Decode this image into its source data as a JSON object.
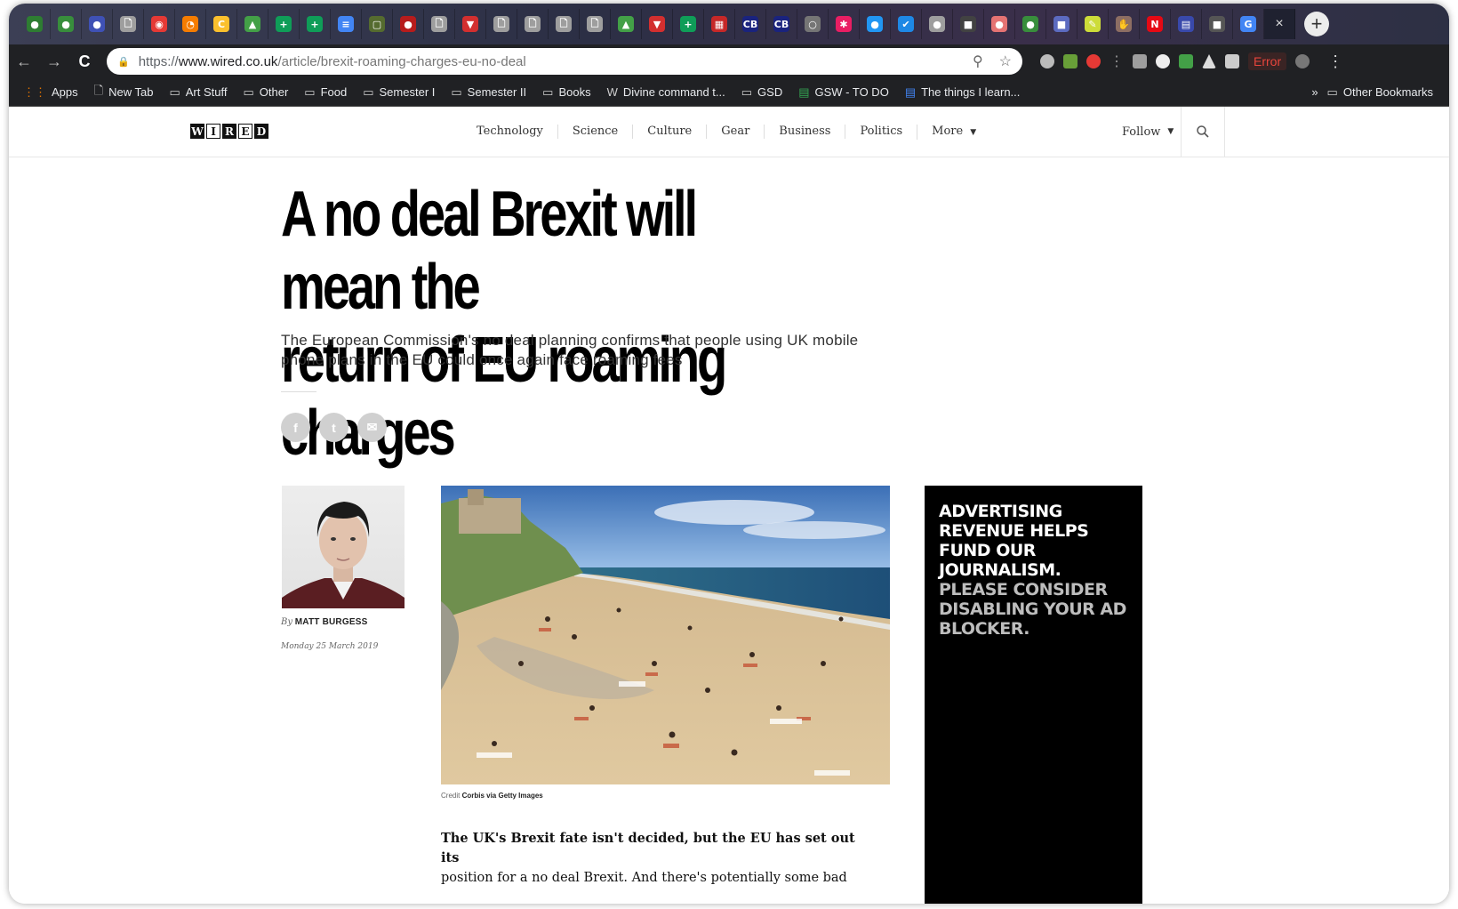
{
  "browser": {
    "tabs": [
      {
        "icon": "leaf-icon",
        "color": "#2e7d32",
        "glyph": "●"
      },
      {
        "icon": "leaf-icon",
        "color": "#388e3c",
        "glyph": "●"
      },
      {
        "icon": "circle-icon",
        "color": "#3f51b5",
        "glyph": "●"
      },
      {
        "icon": "page-icon",
        "color": "#9e9e9e",
        "glyph": "🗋"
      },
      {
        "icon": "map-pin-icon",
        "color": "#e53935",
        "glyph": "◉"
      },
      {
        "icon": "colorwheel-icon",
        "color": "#f57c00",
        "glyph": "◔"
      },
      {
        "icon": "canvas-icon",
        "color": "#fbc02d",
        "glyph": "C"
      },
      {
        "icon": "drive-icon",
        "color": "#43a047",
        "glyph": "▲"
      },
      {
        "icon": "sheets-icon",
        "color": "#0f9d58",
        "glyph": "+"
      },
      {
        "icon": "sheets-icon",
        "color": "#0f9d58",
        "glyph": "+"
      },
      {
        "icon": "docs-icon",
        "color": "#4285f4",
        "glyph": "≡"
      },
      {
        "icon": "page-icon",
        "color": "#556b2f",
        "glyph": "▢"
      },
      {
        "icon": "circle-icon",
        "color": "#b71c1c",
        "glyph": "●"
      },
      {
        "icon": "page-icon",
        "color": "#9e9e9e",
        "glyph": "🗋"
      },
      {
        "icon": "shield-icon",
        "color": "#d32f2f",
        "glyph": "▼"
      },
      {
        "icon": "page-icon",
        "color": "#9e9e9e",
        "glyph": "🗋"
      },
      {
        "icon": "page-icon",
        "color": "#9e9e9e",
        "glyph": "🗋"
      },
      {
        "icon": "page-icon",
        "color": "#9e9e9e",
        "glyph": "🗋"
      },
      {
        "icon": "page-icon",
        "color": "#9e9e9e",
        "glyph": "🗋"
      },
      {
        "icon": "drive-icon",
        "color": "#43a047",
        "glyph": "▲"
      },
      {
        "icon": "shield-icon",
        "color": "#d32f2f",
        "glyph": "▼"
      },
      {
        "icon": "sheets-icon",
        "color": "#0f9d58",
        "glyph": "+"
      },
      {
        "icon": "grid-icon",
        "color": "#c62828",
        "glyph": "▦"
      },
      {
        "icon": "cb-icon",
        "color": "#1a237e",
        "glyph": "CB"
      },
      {
        "icon": "cb-icon",
        "color": "#1a237e",
        "glyph": "CB"
      },
      {
        "icon": "circle-icon",
        "color": "#757575",
        "glyph": "○"
      },
      {
        "icon": "asterisk-icon",
        "color": "#e91e63",
        "glyph": "✱"
      },
      {
        "icon": "chat-icon",
        "color": "#2196f3",
        "glyph": "●"
      },
      {
        "icon": "check-icon",
        "color": "#1e88e5",
        "glyph": "✔"
      },
      {
        "icon": "circle-icon",
        "color": "#9e9e9e",
        "glyph": "●"
      },
      {
        "icon": "square-icon",
        "color": "#424242",
        "glyph": "■"
      },
      {
        "icon": "brain-icon",
        "color": "#e57373",
        "glyph": "●"
      },
      {
        "icon": "leaf-icon",
        "color": "#388e3c",
        "glyph": "●"
      },
      {
        "icon": "square-icon",
        "color": "#5c6bc0",
        "glyph": "■"
      },
      {
        "icon": "pen-icon",
        "color": "#cddc39",
        "glyph": "✎"
      },
      {
        "icon": "hand-icon",
        "color": "#8d6e63",
        "glyph": "✋"
      },
      {
        "icon": "netflix-icon",
        "color": "#e50914",
        "glyph": "N"
      },
      {
        "icon": "calendar-icon",
        "color": "#3949ab",
        "glyph": "▤"
      },
      {
        "icon": "square-icon",
        "color": "#555555",
        "glyph": "■"
      },
      {
        "icon": "google-icon",
        "color": "#ffffff",
        "glyph": "G"
      }
    ],
    "active_tab": {
      "icon": "google-icon",
      "glyph": "G"
    },
    "url": {
      "scheme": "https://",
      "host": "www.wired.co.uk",
      "path": "/article/brexit-roaming-charges-eu-no-deal"
    },
    "extension_error": "Error",
    "bookmarks": [
      {
        "label": "Apps",
        "icon": "apps-grid-icon"
      },
      {
        "label": "New Tab",
        "icon": "page-icon"
      },
      {
        "label": "Art Stuff",
        "icon": "folder-icon"
      },
      {
        "label": "Other",
        "icon": "folder-icon"
      },
      {
        "label": "Food",
        "icon": "folder-icon"
      },
      {
        "label": "Semester I",
        "icon": "folder-icon"
      },
      {
        "label": "Semester II",
        "icon": "folder-icon"
      },
      {
        "label": "Books",
        "icon": "folder-icon"
      },
      {
        "label": "Divine command t...",
        "icon": "wikipedia-icon"
      },
      {
        "label": "GSD",
        "icon": "folder-icon"
      },
      {
        "label": "GSW - TO DO",
        "icon": "sheets-icon"
      },
      {
        "label": "The things I learn...",
        "icon": "docs-icon"
      }
    ],
    "bookmarks_overflow": "»",
    "other_bookmarks": "Other Bookmarks"
  },
  "site": {
    "logo_letters": [
      "W",
      "I",
      "R",
      "E",
      "D"
    ],
    "nav": [
      "Technology",
      "Science",
      "Culture",
      "Gear",
      "Business",
      "Politics",
      "More"
    ],
    "follow": "Follow"
  },
  "article": {
    "headline_line1": "A no deal Brexit will mean the",
    "headline_line2": "return of EU roaming charges",
    "dek": "The European Commission's no deal planning confirms that people using UK mobile phone plans in the EU could once again face roaming fees",
    "byline_prefix": "By",
    "author": "MATT BURGESS",
    "date": "Monday 25 March 2019",
    "credit_prefix": "Credit",
    "credit": "Corbis via Getty Images",
    "body_line1": "The UK's Brexit fate isn't decided, but the EU has set out its",
    "body_line2": "position for a no deal Brexit. And there's potentially some bad"
  },
  "ad": {
    "line1": "Advertising revenue helps fund our journalism.",
    "line2": "Please consider disabling your ad blocker."
  }
}
